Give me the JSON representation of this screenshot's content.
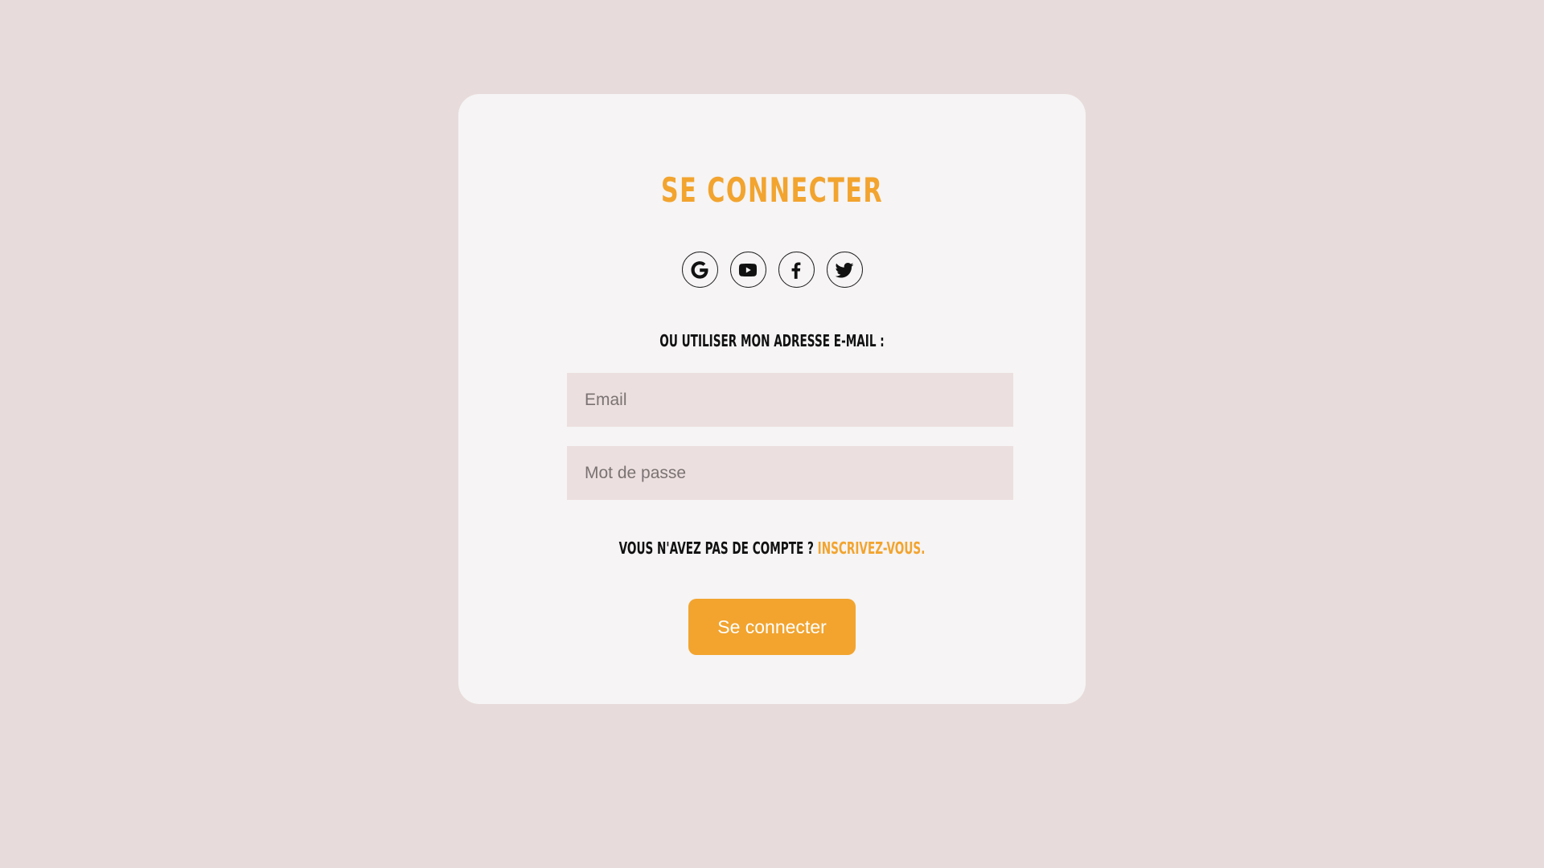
{
  "colors": {
    "background": "#e7dcdb",
    "card": "#f6f4f4",
    "accent": "#f2a42f",
    "input_bg": "#ecdfdf",
    "text": "#111111"
  },
  "login": {
    "title": "SE CONNECTER",
    "socials": [
      {
        "name": "google",
        "icon": "google-icon"
      },
      {
        "name": "youtube",
        "icon": "youtube-icon"
      },
      {
        "name": "facebook",
        "icon": "facebook-icon"
      },
      {
        "name": "twitter",
        "icon": "twitter-icon"
      }
    ],
    "alt_label": "OU UTILISER MON ADRESSE E-MAIL :",
    "email": {
      "placeholder": "Email",
      "value": ""
    },
    "password": {
      "placeholder": "Mot de passe",
      "value": ""
    },
    "signup_prompt": "VOUS N'AVEZ PAS DE COMPTE ?",
    "signup_link": "INSCRIVEZ-VOUS.",
    "submit_label": "Se connecter"
  }
}
